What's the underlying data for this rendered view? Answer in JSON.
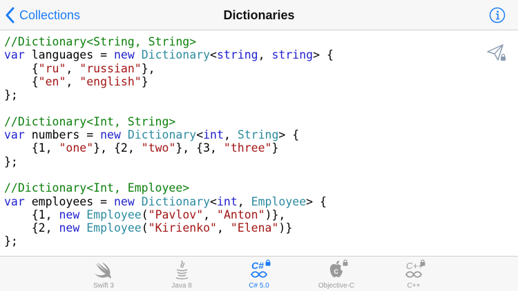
{
  "nav": {
    "back_label": "Collections",
    "title": "Dictionaries"
  },
  "colors": {
    "accent": "#1a7cf5",
    "comment": "#0b7f0b",
    "keyword": "#1f1fcf",
    "type": "#2a8aa0",
    "string": "#a31515",
    "inactive_tab": "#9a9a9a"
  },
  "code_lines": [
    [
      {
        "t": "comment",
        "v": "//Dictionary<String, String>"
      }
    ],
    [
      {
        "t": "keyword",
        "v": "var"
      },
      {
        "t": "plain",
        "v": " languages = "
      },
      {
        "t": "keyword",
        "v": "new"
      },
      {
        "t": "plain",
        "v": " "
      },
      {
        "t": "type",
        "v": "Dictionary"
      },
      {
        "t": "plain",
        "v": "<"
      },
      {
        "t": "keyword",
        "v": "string"
      },
      {
        "t": "plain",
        "v": ", "
      },
      {
        "t": "keyword",
        "v": "string"
      },
      {
        "t": "plain",
        "v": "> {"
      }
    ],
    [
      {
        "t": "plain",
        "v": "    {"
      },
      {
        "t": "string",
        "v": "\"ru\""
      },
      {
        "t": "plain",
        "v": ", "
      },
      {
        "t": "string",
        "v": "\"russian\""
      },
      {
        "t": "plain",
        "v": "},"
      }
    ],
    [
      {
        "t": "plain",
        "v": "    {"
      },
      {
        "t": "string",
        "v": "\"en\""
      },
      {
        "t": "plain",
        "v": ", "
      },
      {
        "t": "string",
        "v": "\"english\""
      },
      {
        "t": "plain",
        "v": "}"
      }
    ],
    [
      {
        "t": "plain",
        "v": "};"
      }
    ],
    [
      {
        "t": "plain",
        "v": ""
      }
    ],
    [
      {
        "t": "comment",
        "v": "//Dictionary<Int, String>"
      }
    ],
    [
      {
        "t": "keyword",
        "v": "var"
      },
      {
        "t": "plain",
        "v": " numbers = "
      },
      {
        "t": "keyword",
        "v": "new"
      },
      {
        "t": "plain",
        "v": " "
      },
      {
        "t": "type",
        "v": "Dictionary"
      },
      {
        "t": "plain",
        "v": "<"
      },
      {
        "t": "keyword",
        "v": "int"
      },
      {
        "t": "plain",
        "v": ", "
      },
      {
        "t": "type",
        "v": "String"
      },
      {
        "t": "plain",
        "v": "> {"
      }
    ],
    [
      {
        "t": "plain",
        "v": "    {1, "
      },
      {
        "t": "string",
        "v": "\"one\""
      },
      {
        "t": "plain",
        "v": "}, {2, "
      },
      {
        "t": "string",
        "v": "\"two\""
      },
      {
        "t": "plain",
        "v": "}, {3, "
      },
      {
        "t": "string",
        "v": "\"three\""
      },
      {
        "t": "plain",
        "v": "}"
      }
    ],
    [
      {
        "t": "plain",
        "v": "};"
      }
    ],
    [
      {
        "t": "plain",
        "v": ""
      }
    ],
    [
      {
        "t": "comment",
        "v": "//Dictionary<Int, Employee>"
      }
    ],
    [
      {
        "t": "keyword",
        "v": "var"
      },
      {
        "t": "plain",
        "v": " employees = "
      },
      {
        "t": "keyword",
        "v": "new"
      },
      {
        "t": "plain",
        "v": " "
      },
      {
        "t": "type",
        "v": "Dictionary"
      },
      {
        "t": "plain",
        "v": "<"
      },
      {
        "t": "keyword",
        "v": "int"
      },
      {
        "t": "plain",
        "v": ", "
      },
      {
        "t": "type",
        "v": "Employee"
      },
      {
        "t": "plain",
        "v": "> {"
      }
    ],
    [
      {
        "t": "plain",
        "v": "    {1, "
      },
      {
        "t": "keyword",
        "v": "new"
      },
      {
        "t": "plain",
        "v": " "
      },
      {
        "t": "type",
        "v": "Employee"
      },
      {
        "t": "plain",
        "v": "("
      },
      {
        "t": "string",
        "v": "\"Pavlov\""
      },
      {
        "t": "plain",
        "v": ", "
      },
      {
        "t": "string",
        "v": "\"Anton\""
      },
      {
        "t": "plain",
        "v": ")},"
      }
    ],
    [
      {
        "t": "plain",
        "v": "    {2, "
      },
      {
        "t": "keyword",
        "v": "new"
      },
      {
        "t": "plain",
        "v": " "
      },
      {
        "t": "type",
        "v": "Employee"
      },
      {
        "t": "plain",
        "v": "("
      },
      {
        "t": "string",
        "v": "\"Kirienko\""
      },
      {
        "t": "plain",
        "v": ", "
      },
      {
        "t": "string",
        "v": "\"Elena\""
      },
      {
        "t": "plain",
        "v": ")}"
      }
    ],
    [
      {
        "t": "plain",
        "v": "};"
      }
    ]
  ],
  "tabs": [
    {
      "label": "Swift 3",
      "icon": "swift-icon",
      "active": false,
      "locked": false
    },
    {
      "label": "Java 8",
      "icon": "java-icon",
      "active": false,
      "locked": false
    },
    {
      "label": "C# 5.0",
      "icon": "csharp-icon",
      "active": true,
      "locked": true
    },
    {
      "label": "Objective-C",
      "icon": "apple-icon",
      "active": false,
      "locked": true
    },
    {
      "label": "C++",
      "icon": "cpp-icon",
      "active": false,
      "locked": true
    }
  ]
}
